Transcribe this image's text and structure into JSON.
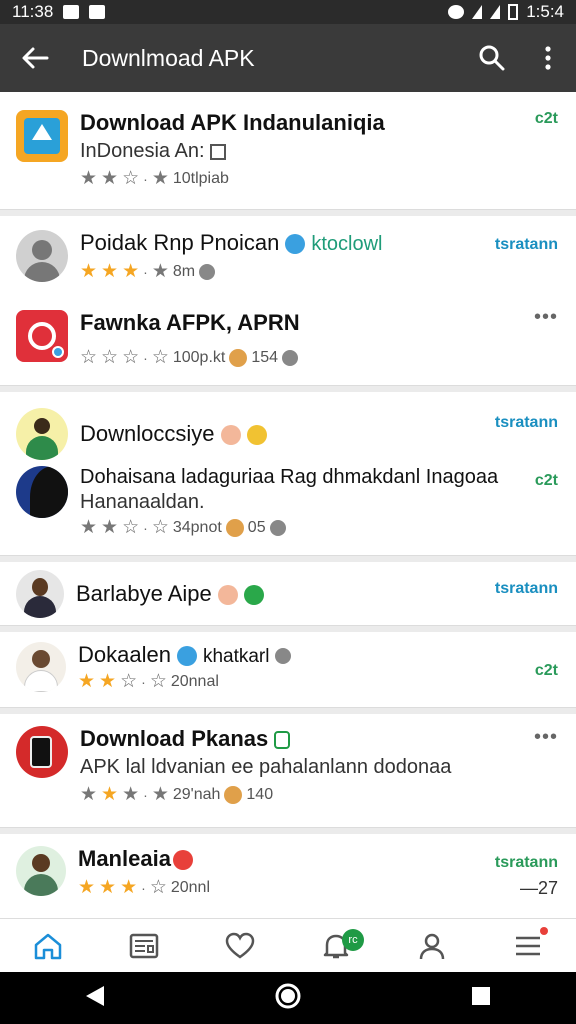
{
  "status_bar": {
    "time_left": "11:38",
    "time_right": "1:5:4"
  },
  "app_bar": {
    "title": "Downlmoad APK"
  },
  "colors": {
    "green_tag": "#2a9a5a",
    "blue_tag": "#1a8fc0",
    "star": "#f5a623",
    "accent": "#1b8ed8"
  },
  "items": [
    {
      "name": "Download APK Indanulaniqia",
      "sub": "InDonesia An:",
      "stars": [
        1,
        1,
        0,
        1
      ],
      "meta_text": "10tlpiab",
      "right": "c2t"
    },
    {
      "name": "Poidak Rnp Pnoican",
      "link": "ktoclowl",
      "stars": [
        1,
        1,
        1,
        0
      ],
      "meta_text": "8m",
      "right": "tsratann"
    },
    {
      "name": "Fawnka AFPK, APRN",
      "stars": [
        0,
        0,
        0,
        0
      ],
      "meta_text": "100p.kt",
      "meta_num": "154",
      "right": "•••"
    },
    {
      "name": "Downloccsiye",
      "right": "tsratann"
    },
    {
      "name": "Dohaisana ladaguriaa Rag dhmakdanl Inagoaa",
      "sub": "Hananaaldan.",
      "stars": [
        0,
        0,
        0,
        0
      ],
      "meta_text": "34pnot",
      "meta_num": "05",
      "right": "c2t"
    },
    {
      "name": "Barlabye Aipe",
      "right": "tsratann"
    },
    {
      "name": "Dokaalen",
      "link": "khatkarl",
      "stars": [
        1,
        1,
        0,
        0
      ],
      "meta_text": "20nnal",
      "right": "c2t"
    },
    {
      "name": "Download Pkanas",
      "sub": "APK lal ldvanian ee pahalanlann dodonaa",
      "stars": [
        0,
        1,
        1,
        0
      ],
      "meta_text": "29'nah",
      "meta_num": "140",
      "right": "•••"
    },
    {
      "name": "Manleaia",
      "stars": [
        1,
        1,
        1,
        0
      ],
      "meta_text": "20nnl",
      "right": "tsratann",
      "right_sub": "—27"
    }
  ],
  "bottom_nav": {
    "notif_badge": "rc"
  }
}
